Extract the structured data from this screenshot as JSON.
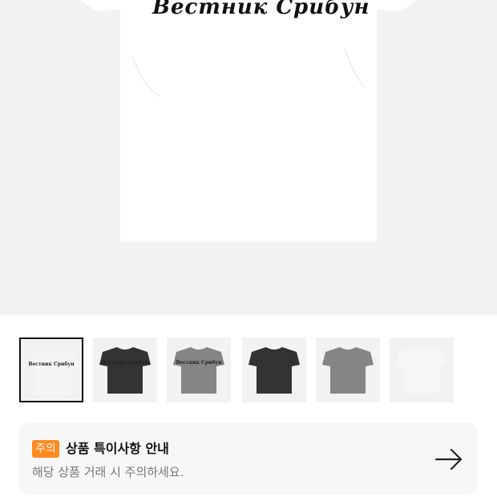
{
  "product": {
    "print_text": "Вестник Срибун",
    "thumbnails": [
      {
        "color": "#f4f4f4",
        "print": "Вестник Срибун",
        "selected": true
      },
      {
        "color": "#333333",
        "print": "Вестник Срибун",
        "selected": false
      },
      {
        "color": "#858585",
        "print": "Вестник Срибун",
        "selected": false
      },
      {
        "color": "#333333",
        "print": "",
        "selected": false
      },
      {
        "color": "#858585",
        "print": "",
        "selected": false
      },
      {
        "color": "#f6f6f6",
        "print": "",
        "selected": false
      }
    ]
  },
  "notice": {
    "badge": "주의",
    "title": "상품 특이사항 안내",
    "description": "해당 상품 거래 시 주의하세요.",
    "arrow_icon": "arrow-right-icon",
    "badge_color": "#ff8a1e"
  }
}
